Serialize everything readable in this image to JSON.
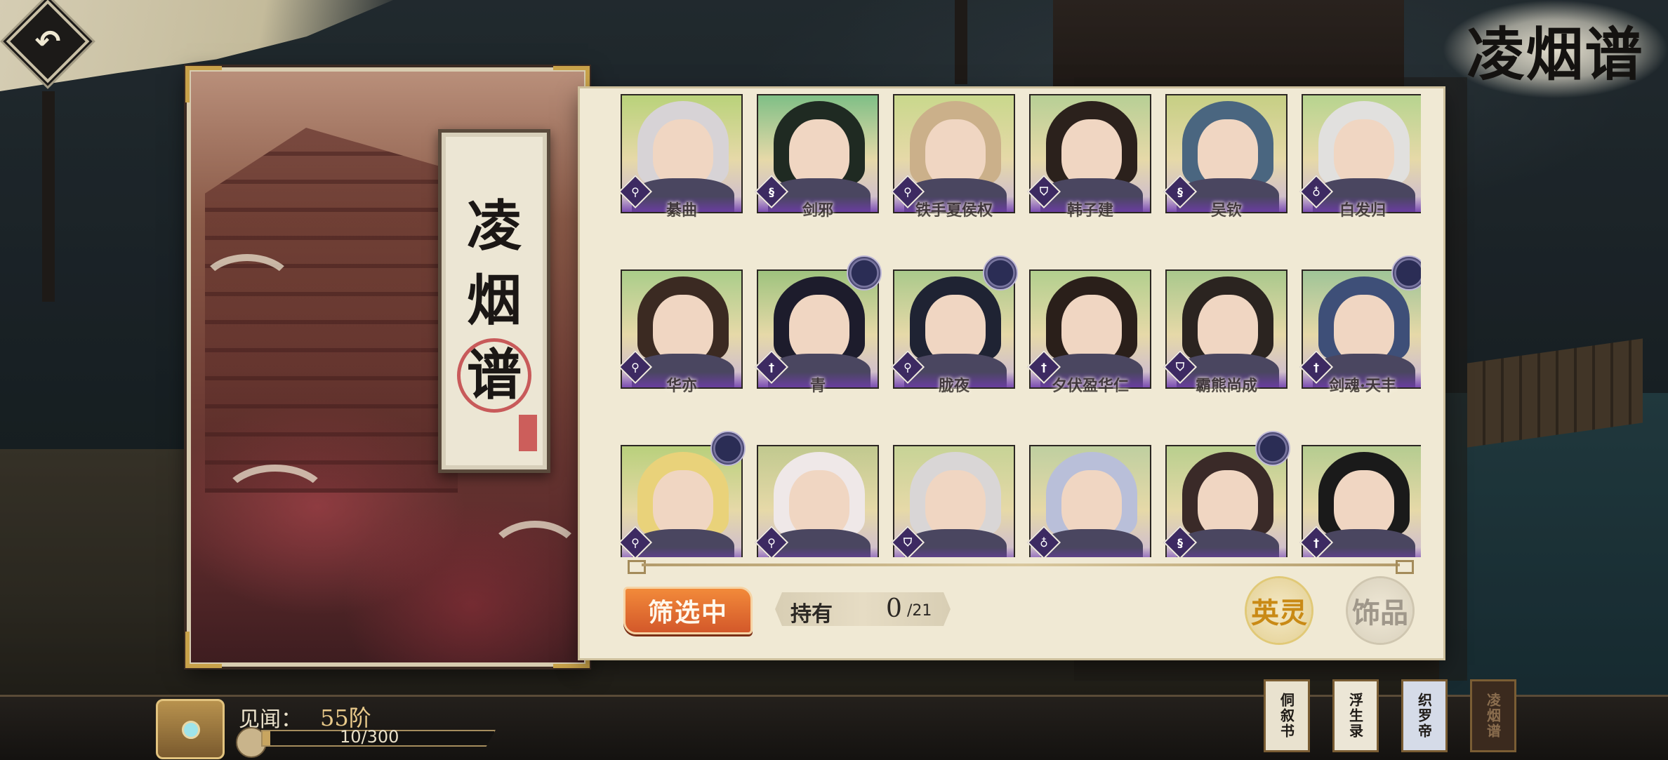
{
  "page": {
    "title": "凌烟谱",
    "back_icon": "back-arrow-icon"
  },
  "book": {
    "tablet_chars": [
      "凌",
      "烟",
      "谱"
    ]
  },
  "roster": {
    "rows": [
      [
        {
          "name": "綦曲",
          "type_icon": "scroll-icon",
          "bg": "#b9d27a"
        },
        {
          "name": "剑邪",
          "type_icon": "swirl-icon",
          "bg": "#7fbf86"
        },
        {
          "name": "铁手夏侯权",
          "type_icon": "scroll-icon",
          "bg": "#c9d88c"
        },
        {
          "name": "韩子建",
          "type_icon": "shield-icon",
          "bg": "#b7cf95"
        },
        {
          "name": "吴钦",
          "type_icon": "swirl-icon",
          "bg": "#c6cf84"
        },
        {
          "name": "白发归",
          "type_icon": "gourd-icon",
          "bg": "#b7d48f"
        }
      ],
      [
        {
          "name": "华亦",
          "type_icon": "scroll-icon",
          "bg": "#aacd8a",
          "badge": false
        },
        {
          "name": "青",
          "type_icon": "sword-icon",
          "bg": "#9ec37e",
          "badge": true
        },
        {
          "name": "胧夜",
          "type_icon": "scroll-icon",
          "bg": "#aac98b",
          "badge": true
        },
        {
          "name": "夕伏盈华仁",
          "type_icon": "sword-icon",
          "bg": "#b2cf8e",
          "badge": false
        },
        {
          "name": "霸熊尚成",
          "type_icon": "shield-icon",
          "bg": "#a9c88c",
          "badge": false
        },
        {
          "name": "剑魂·天丰",
          "type_icon": "sword-icon",
          "bg": "#9fc497",
          "badge": true
        }
      ],
      [
        {
          "name": "",
          "type_icon": "scroll-icon",
          "bg": "#b9d07c",
          "badge": true
        },
        {
          "name": "",
          "type_icon": "scroll-icon",
          "bg": "#c1c98f",
          "badge": false
        },
        {
          "name": "",
          "type_icon": "shield-icon",
          "bg": "#c7d396",
          "badge": false
        },
        {
          "name": "",
          "type_icon": "gourd-icon",
          "bg": "#bfcfa0",
          "badge": false
        },
        {
          "name": "",
          "type_icon": "swirl-icon",
          "bg": "#b9cf8e",
          "badge": true
        },
        {
          "name": "",
          "type_icon": "sword-icon",
          "bg": "#b5cc90",
          "badge": false
        }
      ]
    ]
  },
  "filter": {
    "label": "筛选中"
  },
  "owned": {
    "label": "持有",
    "count": "0",
    "total": "/21"
  },
  "tabs": {
    "hero": "英灵",
    "accessory": "饰品"
  },
  "lore": {
    "label": "见闻：",
    "level": "55阶",
    "progress_text": "10/300",
    "progress_fraction": 0.0333
  },
  "book_tabs": [
    {
      "label": "侗叙书",
      "bg": "#e9e2cf",
      "color": "#1f1b17"
    },
    {
      "label": "浮生录",
      "bg": "#ece6d6",
      "color": "#1f1b17"
    },
    {
      "label": "织罗帝",
      "bg": "#d5dbe8",
      "color": "#1f1b17"
    },
    {
      "label": "凌烟谱",
      "bg": "#3b2a1e",
      "color": "#8a6d4e"
    }
  ]
}
